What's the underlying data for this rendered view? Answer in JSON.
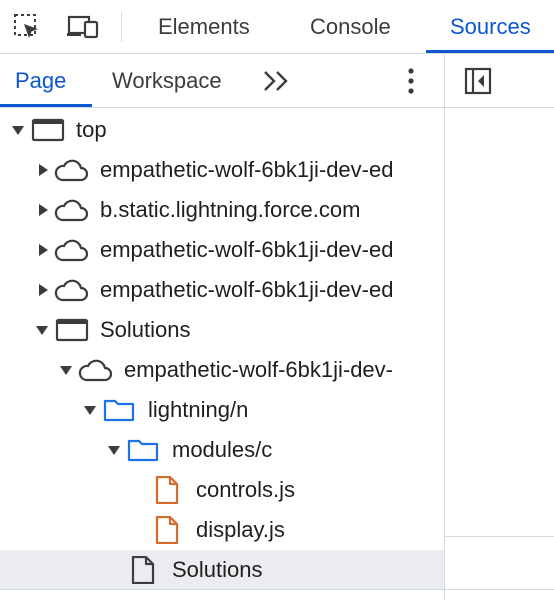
{
  "toolbar": {
    "inspect_icon": "inspect-element-icon",
    "device_icon": "device-toolbar-icon",
    "tabs": [
      {
        "label": "Elements"
      },
      {
        "label": "Console"
      },
      {
        "label": "Sources"
      }
    ],
    "active_tab": "Sources"
  },
  "navigator": {
    "tabs": [
      {
        "label": "Page"
      },
      {
        "label": "Workspace"
      }
    ],
    "active_tab": "Page",
    "more_tabs_icon": "chevron-double-right-icon",
    "menu_icon": "more-vertical-icon"
  },
  "tree": {
    "items": [
      {
        "label": "top",
        "type": "frame",
        "expanded": true
      },
      {
        "label": "empathetic-wolf-6bk1ji-dev-ed",
        "type": "domain",
        "expanded": false
      },
      {
        "label": "b.static.lightning.force.com",
        "type": "domain",
        "expanded": false
      },
      {
        "label": "empathetic-wolf-6bk1ji-dev-ed",
        "type": "domain",
        "expanded": false
      },
      {
        "label": "empathetic-wolf-6bk1ji-dev-ed",
        "type": "domain",
        "expanded": false
      },
      {
        "label": "Solutions",
        "type": "frame",
        "expanded": true
      },
      {
        "label": "empathetic-wolf-6bk1ji-dev-",
        "type": "domain",
        "expanded": true
      },
      {
        "label": "lightning/n",
        "type": "folder",
        "expanded": true
      },
      {
        "label": "modules/c",
        "type": "folder",
        "expanded": true
      },
      {
        "label": "controls.js",
        "type": "script-file"
      },
      {
        "label": "display.js",
        "type": "script-file"
      },
      {
        "label": "Solutions",
        "type": "document",
        "selected": true
      }
    ]
  },
  "right_panel": {
    "toggle_icon": "show-navigator-icon"
  },
  "colors": {
    "accent": "#0b57d0",
    "folder": "#1a73e8",
    "script_file": "#d36b2a",
    "selected_row": "#eaecef",
    "border": "#d3dbe5"
  }
}
